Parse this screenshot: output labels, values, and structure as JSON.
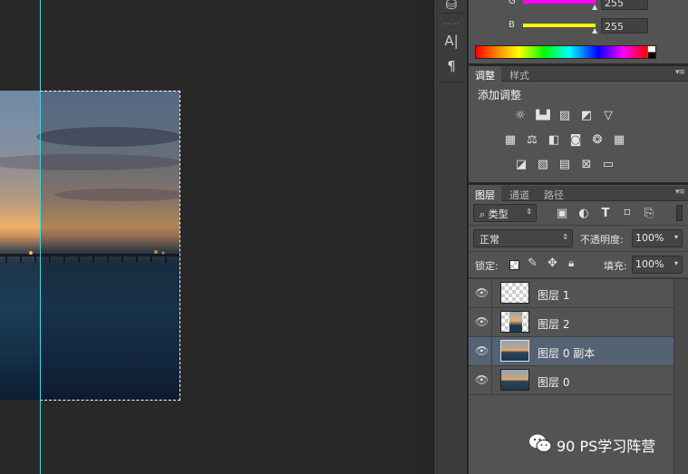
{
  "color_panel": {
    "channels": [
      {
        "label": "G",
        "value": "255",
        "color": "#ff00ff"
      },
      {
        "label": "B",
        "value": "255",
        "color": "#ffff00"
      }
    ]
  },
  "adjustments_panel": {
    "tabs": [
      "调整",
      "样式"
    ],
    "title": "添加调整",
    "icons_row1": [
      "brightness-icon",
      "levels-icon",
      "curves-icon",
      "exposure-icon",
      "vibrance-icon"
    ],
    "icons_row2": [
      "hue-saturation-icon",
      "color-balance-icon",
      "black-white-icon",
      "photo-filter-icon",
      "channel-mixer-icon",
      "color-lookup-icon"
    ],
    "icons_row3": [
      "invert-icon",
      "posterize-icon",
      "threshold-icon",
      "selective-color-icon",
      "gradient-map-icon"
    ]
  },
  "layers_panel": {
    "tabs": [
      "图层",
      "通道",
      "路径"
    ],
    "filter_type": "类型",
    "blend_mode": "正常",
    "opacity_label": "不透明度:",
    "opacity_value": "100%",
    "lock_label": "锁定:",
    "fill_label": "填充:",
    "fill_value": "100%",
    "layers": [
      {
        "name": "图层 1",
        "selected": false,
        "thumb": "transparent"
      },
      {
        "name": "图层 2",
        "selected": false,
        "thumb": "partial"
      },
      {
        "name": "图层 0 副本",
        "selected": true,
        "thumb": "landscape"
      },
      {
        "name": "图层 0",
        "selected": false,
        "thumb": "landscape"
      }
    ]
  },
  "watermark": {
    "text": "90 PS学习阵营"
  },
  "colors": {
    "guide": "#3ad7e0",
    "selected_layer": "#556273",
    "panel_bg": "#535353"
  }
}
